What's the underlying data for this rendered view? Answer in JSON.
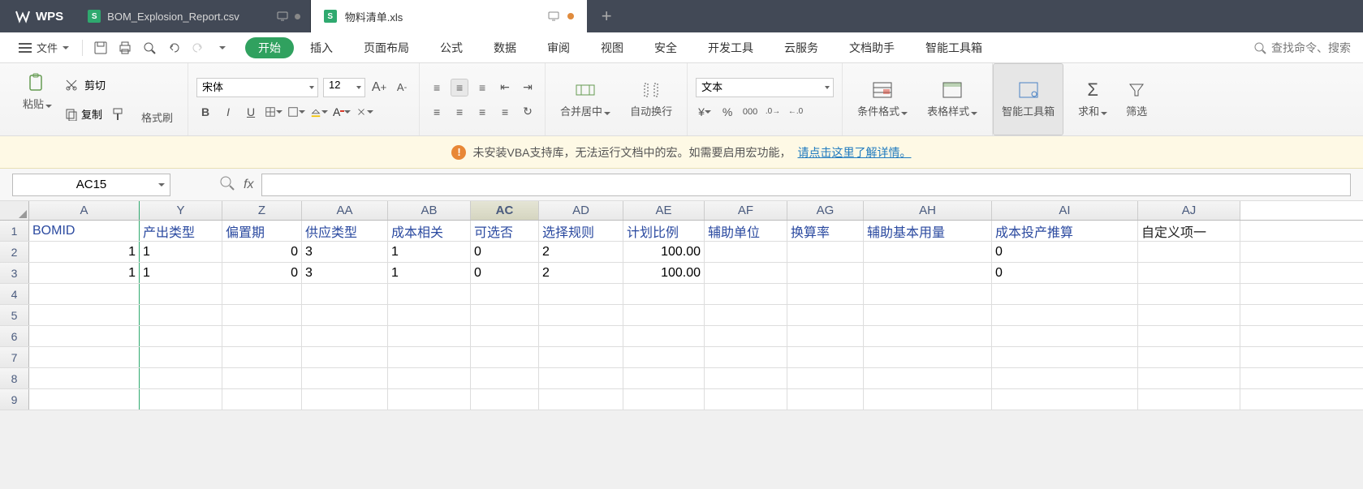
{
  "titlebar": {
    "app": "WPS",
    "tab_inactive": "BOM_Explosion_Report.csv",
    "tab_active": "物料清单.xls",
    "new_tab": "+"
  },
  "menubar": {
    "file": "文件",
    "tabs": [
      "开始",
      "插入",
      "页面布局",
      "公式",
      "数据",
      "审阅",
      "视图",
      "安全",
      "开发工具",
      "云服务",
      "文档助手",
      "智能工具箱"
    ],
    "active_tab_index": 0,
    "search_placeholder": "查找命令、搜索"
  },
  "ribbon": {
    "paste": "粘贴",
    "cut": "剪切",
    "copy": "复制",
    "format_painter": "格式刷",
    "font_name": "宋体",
    "font_size": "12",
    "bold": "B",
    "italic": "I",
    "underline": "U",
    "merge_center": "合并居中",
    "auto_wrap": "自动换行",
    "number_format": "文本",
    "conditional_format": "条件格式",
    "table_style": "表格样式",
    "smart_toolbox": "智能工具箱",
    "sum": "求和",
    "filter": "筛选"
  },
  "warning": {
    "msg_pre": "未安装VBA支持库，无法运行文档中的宏。如需要启用宏功能，",
    "link": "请点击这里了解详情。"
  },
  "formula_bar": {
    "cell_ref": "AC15",
    "fx": "fx",
    "formula": ""
  },
  "grid": {
    "columns": [
      "A",
      "Y",
      "Z",
      "AA",
      "AB",
      "AC",
      "AD",
      "AE",
      "AF",
      "AG",
      "AH",
      "AI",
      "AJ"
    ],
    "selected_col": "AC",
    "headers": {
      "A": "BOMID",
      "Y": "产出类型",
      "Z": "偏置期",
      "AA": "供应类型",
      "AB": "成本相关",
      "AC": "可选否",
      "AD": "选择规则",
      "AE": "计划比例",
      "AF": "辅助单位",
      "AG": "换算率",
      "AH": "辅助基本用量",
      "AI": "成本投产推算",
      "AJ": "自定义项一"
    },
    "rows": [
      {
        "A": "1",
        "Y": "1",
        "Z": "0",
        "AA": "3",
        "AB": "1",
        "AC": "0",
        "AD": "2",
        "AE": "100.00",
        "AF": "",
        "AG": "",
        "AH": "",
        "AI": "0",
        "AJ": ""
      },
      {
        "A": "1",
        "Y": "1",
        "Z": "0",
        "AA": "3",
        "AB": "1",
        "AC": "0",
        "AD": "2",
        "AE": "100.00",
        "AF": "",
        "AG": "",
        "AH": "",
        "AI": "0",
        "AJ": ""
      }
    ],
    "visible_row_numbers": [
      1,
      2,
      3,
      4,
      5,
      6,
      7,
      8,
      9
    ]
  }
}
